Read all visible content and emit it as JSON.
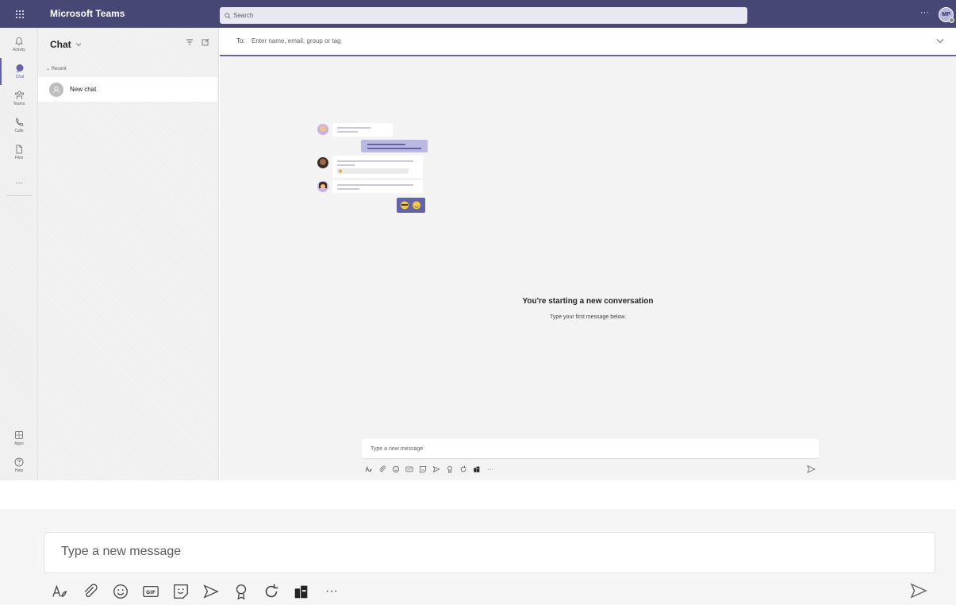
{
  "topbar": {
    "app_title": "Microsoft Teams",
    "search_placeholder": "Search",
    "more_label": "···",
    "avatar_initials": "MP",
    "bg_color": "#464775"
  },
  "rail": {
    "items": [
      {
        "id": "activity",
        "label": "Activity",
        "icon": "bell-icon"
      },
      {
        "id": "chat",
        "label": "Chat",
        "icon": "chat-icon",
        "active": true
      },
      {
        "id": "teams",
        "label": "Teams",
        "icon": "teams-icon"
      },
      {
        "id": "calls",
        "label": "Calls",
        "icon": "phone-icon"
      },
      {
        "id": "files",
        "label": "Files",
        "icon": "file-icon"
      },
      {
        "id": "more",
        "label": "···",
        "icon": "more-icon"
      }
    ],
    "bottom": [
      {
        "id": "apps",
        "label": "Apps",
        "icon": "apps-icon"
      },
      {
        "id": "help",
        "label": "Help",
        "icon": "help-icon"
      }
    ]
  },
  "chatlist": {
    "heading": "Chat",
    "recent_label": "Recent",
    "items": [
      {
        "label": "New chat",
        "icon": "person-icon"
      }
    ]
  },
  "to_bar": {
    "prefix": "To:",
    "placeholder": "Enter name, email, group or tag"
  },
  "empty_state": {
    "title": "You're starting a new conversation",
    "subtitle": "Type your first message below."
  },
  "compose": {
    "placeholder": "Type a new message",
    "toolbar": [
      "format-icon",
      "attach-icon",
      "emoji-icon",
      "gif-icon",
      "sticker-icon",
      "meet-icon",
      "praise-icon",
      "loop-icon",
      "approvals-icon",
      "more-icon"
    ],
    "more_label": "···",
    "gif_label": "GIF",
    "send_icon": "send-icon"
  },
  "colors": {
    "accent": "#6264a7",
    "top_bar": "#464775"
  }
}
